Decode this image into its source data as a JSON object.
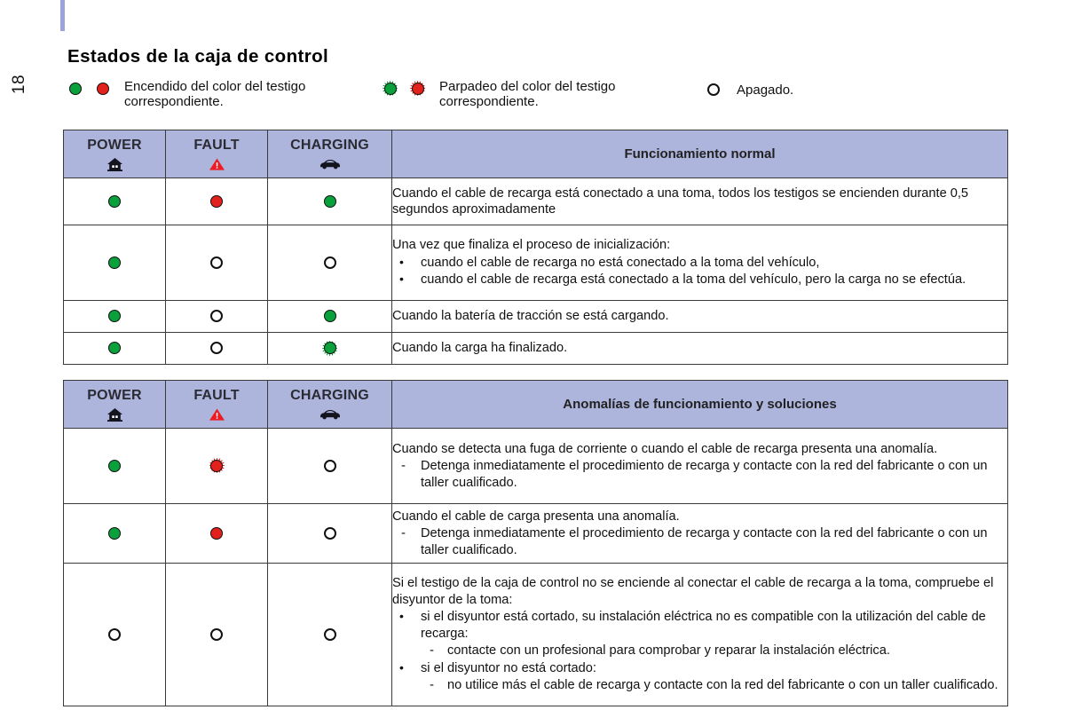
{
  "page": {
    "number": "18",
    "title": "Estados de la caja de control"
  },
  "legend": {
    "items": [
      {
        "lamps": [
          "green-on",
          "red-on"
        ],
        "text": "Encendido del color del testigo\ncorrespondiente."
      },
      {
        "lamps": [
          "green-blink",
          "red-blink"
        ],
        "text": "Parpadeo del color del testigo\ncorrespondiente."
      },
      {
        "lamps": [
          "off"
        ],
        "text": "Apagado."
      }
    ]
  },
  "columns": {
    "power": {
      "label": "POWER",
      "icon": "house-icon"
    },
    "fault": {
      "label": "FAULT",
      "icon": "warning-triangle-icon"
    },
    "charging": {
      "label": "CHARGING",
      "icon": "car-icon"
    }
  },
  "tables": [
    {
      "id": "normal-operation",
      "header_description": "Funcionamiento normal",
      "rows": [
        {
          "power": "green-on",
          "fault": "red-on",
          "charging": "green-on",
          "text": "Cuando el cable de recarga está conectado a una toma, todos los testigos se enciendendurante 0,5 segundos aproximadamente",
          "paragraph": "Cuando el cable de recarga está conectado a una toma, todos los testigos se encienden durante 0,5 segundos aproximadamente",
          "bullets": [],
          "dashes": []
        },
        {
          "power": "green-on",
          "fault": "off",
          "charging": "off",
          "paragraph": "Una vez que finaliza el proceso de inicialización:",
          "bullets": [
            "cuando el cable de recarga no está conectado a la toma del vehículo,",
            "cuando el cable de recarga está conectado a la toma del vehículo, pero la carga no se efectúa."
          ],
          "dashes": []
        },
        {
          "power": "green-on",
          "fault": "off",
          "charging": "green-on",
          "paragraph": "Cuando la batería de tracción se está cargando.",
          "bullets": [],
          "dashes": []
        },
        {
          "power": "green-on",
          "fault": "off",
          "charging": "green-blink",
          "paragraph": "Cuando la carga ha finalizado.",
          "bullets": [],
          "dashes": []
        }
      ]
    },
    {
      "id": "faults-and-solutions",
      "header_description": "Anomalías de funcionamiento y soluciones",
      "rows": [
        {
          "power": "green-on",
          "fault": "red-blink",
          "charging": "off",
          "paragraph": "Cuando se detecta una fuga de corriente o cuando el cable de recarga presenta una anomalía.",
          "bullets": [],
          "dashes": [
            "Detenga inmediatamente el procedimiento de recarga y contacte con la red del fabricante o con un taller cualificado."
          ]
        },
        {
          "power": "green-on",
          "fault": "red-on",
          "charging": "off",
          "paragraph": "Cuando el cable de carga presenta una anomalía.",
          "bullets": [],
          "dashes": [
            "Detenga inmediatamente el procedimiento de recarga y contacte con la red del fabricante o con un taller cualificado."
          ]
        },
        {
          "power": "off",
          "fault": "off",
          "charging": "off",
          "paragraph": "Si el testigo de la caja de control no se enciende al conectar el cable de recarga a la toma, compruebe el disyuntor de la toma:",
          "bullets": [
            "si el disyuntor está cortado, su instalación eléctrica no es compatible con la utilización del cable de recarga:"
          ],
          "sub_dashes_1": [
            "contacte con un profesional para comprobar y reparar la instalación eléctrica."
          ],
          "bullets2": [
            "si el disyuntor no está cortado:"
          ],
          "sub_dashes_2": [
            "no utilice más el cable de recarga y contacte con la red del fabricante o con un taller cualificado."
          ],
          "dashes": []
        }
      ]
    }
  ],
  "colors": {
    "header_bg": "#aeb5dd",
    "border": "#3a3a3a",
    "lamp_green": "#0aa03c",
    "lamp_red": "#e2211c",
    "warning_red": "#ed1c24",
    "accent_bar": "#9ba4d6"
  }
}
